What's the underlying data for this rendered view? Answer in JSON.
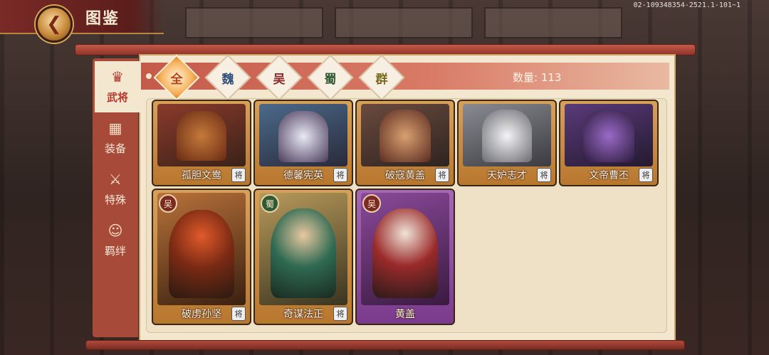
{
  "header": {
    "title": "图鉴",
    "build_id": "02-109348354-2521.1-101~1"
  },
  "side_tabs": [
    {
      "label": "武将",
      "icon": "helmet-icon",
      "active": true
    },
    {
      "label": "装备",
      "icon": "armor-icon",
      "active": false
    },
    {
      "label": "特殊",
      "icon": "sword-icon",
      "active": false
    },
    {
      "label": "羁绊",
      "icon": "people-icon",
      "active": false
    }
  ],
  "factions": [
    {
      "label": "全",
      "color": "#b0471a",
      "active": true
    },
    {
      "label": "魏",
      "color": "#2f4f7a",
      "active": false
    },
    {
      "label": "吴",
      "color": "#8b2a2a",
      "active": false
    },
    {
      "label": "蜀",
      "color": "#2f5a35",
      "active": false
    },
    {
      "label": "群",
      "color": "#7a6a1e",
      "active": false
    }
  ],
  "count_text": "数量: 113",
  "cards": [
    {
      "name": "孤胆文鸯",
      "frame": "gold",
      "seal": "将",
      "art": "#8a3a2a"
    },
    {
      "name": "德馨宪英",
      "frame": "gold",
      "seal": "将",
      "art": "#3f5a7a"
    },
    {
      "name": "破寇黄盖",
      "frame": "gold",
      "seal": "将",
      "art": "#5a3a32"
    },
    {
      "name": "天妒志才",
      "frame": "gold",
      "seal": "将",
      "art": "#6a6a72"
    },
    {
      "name": "文帝曹丕",
      "frame": "gold",
      "seal": "将",
      "art": "#4a2f66"
    },
    {
      "name": "破虏孙坚",
      "frame": "gold",
      "seal": "将",
      "badge": "吴",
      "art": "#7a2a1a"
    },
    {
      "name": "奇谋法正",
      "frame": "gold",
      "seal": "将",
      "badge": "蜀",
      "art": "#2f5a45"
    },
    {
      "name": "黄盖",
      "frame": "purple",
      "badge": "吴",
      "art": "#5a2a2a"
    }
  ]
}
